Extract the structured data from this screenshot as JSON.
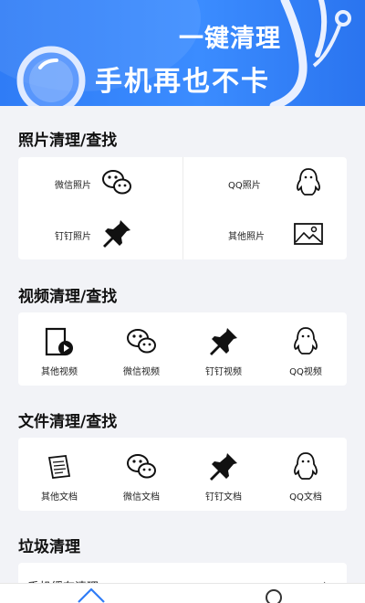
{
  "banner": {
    "title_line1": "一键清理",
    "title_line2": "手机再也不卡",
    "accent": "#2f7cf6"
  },
  "sections": {
    "photos": {
      "title": "照片清理/查找",
      "items": [
        {
          "label": "微信照片",
          "icon": "wechat-icon"
        },
        {
          "label": "QQ照片",
          "icon": "qq-penguin-icon"
        },
        {
          "label": "钉钉照片",
          "icon": "pushpin-icon"
        },
        {
          "label": "其他照片",
          "icon": "picture-icon"
        }
      ]
    },
    "videos": {
      "title": "视频清理/查找",
      "items": [
        {
          "label": "其他视频",
          "icon": "video-file-icon"
        },
        {
          "label": "微信视频",
          "icon": "wechat-icon"
        },
        {
          "label": "钉钉视频",
          "icon": "pushpin-icon"
        },
        {
          "label": "QQ视频",
          "icon": "qq-penguin-icon"
        }
      ]
    },
    "files": {
      "title": "文件清理/查找",
      "items": [
        {
          "label": "其他文档",
          "icon": "document-icon"
        },
        {
          "label": "微信文档",
          "icon": "wechat-icon"
        },
        {
          "label": "钉钉文档",
          "icon": "pushpin-icon"
        },
        {
          "label": "QQ文档",
          "icon": "qq-penguin-icon"
        }
      ]
    },
    "junk": {
      "title": "垃圾清理",
      "row_label": "手机缓存清理",
      "chevron": "›"
    }
  },
  "bottom_nav": {
    "items": [
      {
        "icon": "home-icon"
      },
      {
        "icon": "profile-icon"
      }
    ]
  }
}
